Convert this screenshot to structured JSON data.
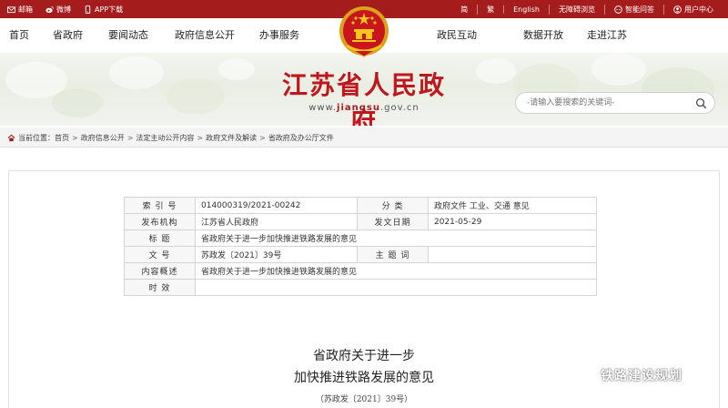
{
  "topbar": {
    "left": [
      {
        "icon": "mail-icon",
        "label": "邮箱"
      },
      {
        "icon": "weibo-icon",
        "label": "微博"
      },
      {
        "icon": "app-icon",
        "label": "APP下载"
      }
    ],
    "right": [
      {
        "label": "简"
      },
      {
        "label": "繁"
      },
      {
        "label": "English"
      },
      {
        "label": "无障碍浏览"
      },
      {
        "icon": "chat-icon",
        "label": "智能问答"
      },
      {
        "icon": "user-icon",
        "label": "用户中心"
      }
    ]
  },
  "nav": {
    "items": [
      "首页",
      "省政府",
      "要闻动态",
      "政府信息公开",
      "办事服务",
      "政民互动",
      "数据开放",
      "走进江苏"
    ]
  },
  "banner": {
    "title": "江苏省人民政府",
    "url_prefix": "www.",
    "url_domain": "jiangsu",
    "url_suffix": ".gov.cn",
    "search_placeholder": "-请输入要搜索的关键词-"
  },
  "breadcrumb": {
    "label": "当前位置：",
    "items": [
      "首页",
      "政府信息公开",
      "法定主动公开内容",
      "政府文件及解读",
      "省政府及办公厅文件"
    ]
  },
  "meta": {
    "index_label": "索 引 号",
    "index_value": "014000319/2021-00242",
    "category_label": "分 类",
    "category_value": "政府文件 工业、交通 意见",
    "issuer_label": "发布机构",
    "issuer_value": "江苏省人民政府",
    "date_label": "发文日期",
    "date_value": "2021-05-29",
    "title_label": "标 题",
    "title_value": "省政府关于进一步加快推进铁路发展的意见",
    "docno_label": "文 号",
    "docno_value": "苏政发〔2021〕39号",
    "subject_label": "主 题 词",
    "subject_value": "",
    "summary_label": "内容概述",
    "summary_value": "省政府关于进一步加快推进铁路发展的意见",
    "validity_label": "时 效",
    "validity_value": ""
  },
  "document": {
    "title_line1": "省政府关于进一步",
    "title_line2": "加快推进铁路发展的意见",
    "number": "（苏政发〔2021〕39号）"
  },
  "watermark": {
    "icon": "wechat-icon",
    "text": "铁路建设规划"
  },
  "colors": {
    "brand_red": "#a51c1c",
    "title_red": "#c0171d"
  }
}
